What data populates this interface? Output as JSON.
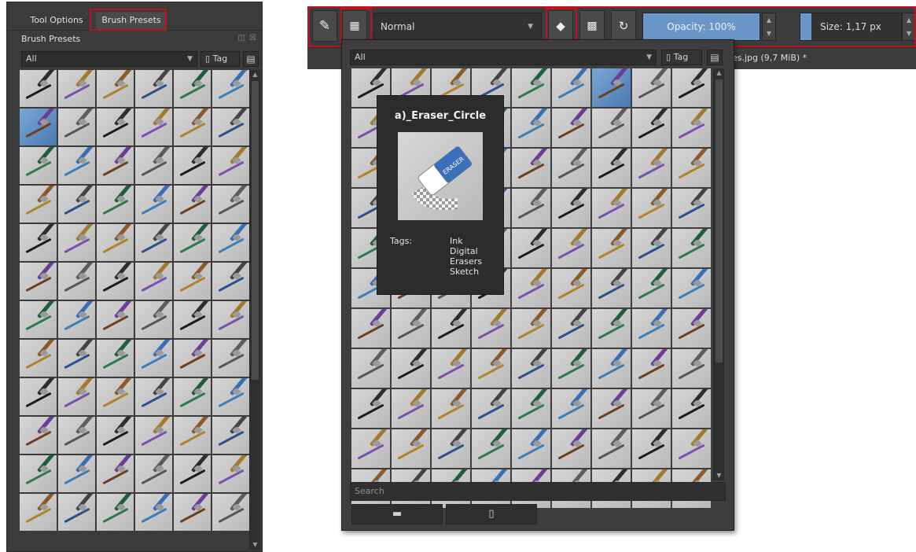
{
  "left_docker": {
    "tabs": [
      {
        "label": "Tool Options",
        "active": false
      },
      {
        "label": "Brush Presets",
        "active": true
      }
    ],
    "title": "Brush Presets",
    "filter": {
      "value": "All"
    },
    "tag_label": "Tag",
    "rows": 12,
    "cols": 6,
    "selected_index": 6
  },
  "toolbar": {
    "icons": [
      "brush-tip-icon",
      "presets-grid-icon",
      "eraser-icon",
      "alpha-lock-icon",
      "reload-icon"
    ],
    "blend_mode": "Normal",
    "opacity": {
      "label": "Opacity:",
      "value": "100%"
    },
    "size": {
      "label": "Size:",
      "value": "1,17 px"
    }
  },
  "status": {
    "filename": "es.jpg (9,7 MiB) *"
  },
  "popup": {
    "filter": {
      "value": "All"
    },
    "tag_label": "Tag",
    "rows": 11,
    "cols": 9,
    "selected_index": 6,
    "search_placeholder": "Search",
    "buttons": [
      {
        "icon": "folder-icon",
        "glyph": "▬"
      },
      {
        "icon": "trash-icon",
        "glyph": "🗑"
      }
    ]
  },
  "tooltip": {
    "title": "a)_Eraser_Circle",
    "tags_label": "Tags:",
    "tags": [
      "Ink",
      "Digital",
      "Erasers",
      "Sketch"
    ]
  },
  "colors": {
    "accent": "#6b96c8",
    "highlight_red": "#c0121b",
    "panel_bg": "#3b3b3b",
    "cell_bg": "#c8c8c8",
    "selected_cell": "#5a8cc4"
  }
}
